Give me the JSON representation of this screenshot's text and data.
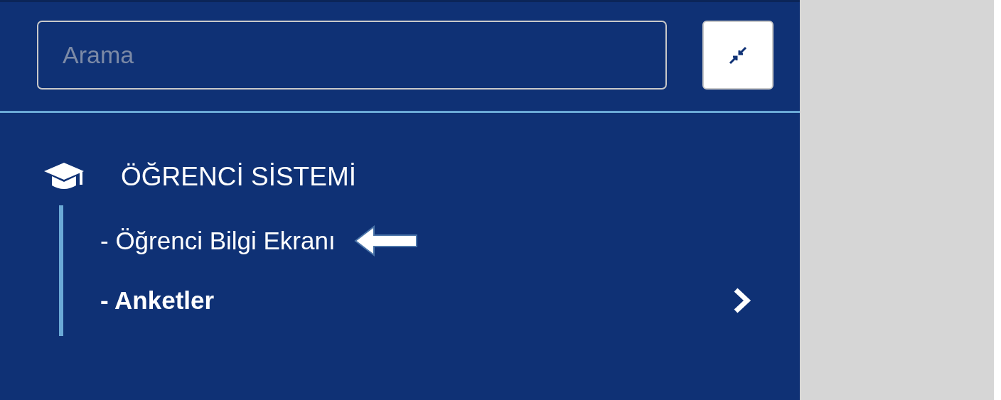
{
  "search": {
    "placeholder": "Arama"
  },
  "menu": {
    "title": "ÖĞRENCİ SİSTEMİ",
    "items": [
      {
        "label": "- Öğrenci Bilgi Ekranı",
        "has_submenu": false,
        "pointed": true
      },
      {
        "label": "- Anketler",
        "has_submenu": true,
        "pointed": false
      }
    ]
  }
}
